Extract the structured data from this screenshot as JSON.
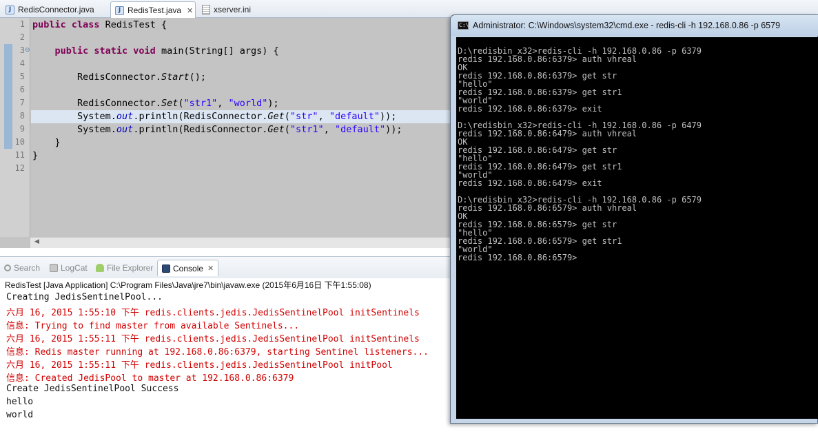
{
  "editor_tabs": [
    {
      "label": "RedisConnector.java",
      "icon": "java-file-icon"
    },
    {
      "label": "RedisTest.java",
      "icon": "java-file-icon",
      "active": true
    },
    {
      "label": "xserver.ini",
      "icon": "ini-file-icon"
    }
  ],
  "editor": {
    "line_numbers": [
      "1",
      "2",
      "3",
      "4",
      "5",
      "6",
      "7",
      "8",
      "9",
      "10",
      "11",
      "12"
    ],
    "lines": [
      [
        {
          "t": "public class",
          "c": "kw"
        },
        {
          "t": " RedisTest {",
          "c": ""
        }
      ],
      [],
      [
        {
          "t": "    ",
          "c": ""
        },
        {
          "t": "public static void",
          "c": "kw"
        },
        {
          "t": " main(String[] args) {",
          "c": ""
        }
      ],
      [],
      [
        {
          "t": "        RedisConnector.",
          "c": ""
        },
        {
          "t": "Start",
          "c": "sm"
        },
        {
          "t": "();",
          "c": ""
        }
      ],
      [],
      [
        {
          "t": "        RedisConnector.",
          "c": ""
        },
        {
          "t": "Set",
          "c": "sm"
        },
        {
          "t": "(",
          "c": ""
        },
        {
          "t": "\"str1\"",
          "c": "str"
        },
        {
          "t": ", ",
          "c": ""
        },
        {
          "t": "\"world\"",
          "c": "str"
        },
        {
          "t": ");",
          "c": ""
        }
      ],
      [
        {
          "t": "        System.",
          "c": ""
        },
        {
          "t": "out",
          "c": "fld"
        },
        {
          "t": ".println(RedisConnector.",
          "c": ""
        },
        {
          "t": "Get",
          "c": "sm"
        },
        {
          "t": "(",
          "c": ""
        },
        {
          "t": "\"str\"",
          "c": "str"
        },
        {
          "t": ", ",
          "c": ""
        },
        {
          "t": "\"default\"",
          "c": "str"
        },
        {
          "t": "));",
          "c": ""
        }
      ],
      [
        {
          "t": "        System.",
          "c": ""
        },
        {
          "t": "out",
          "c": "fld"
        },
        {
          "t": ".println(RedisConnector.",
          "c": ""
        },
        {
          "t": "Get",
          "c": "sm"
        },
        {
          "t": "(",
          "c": ""
        },
        {
          "t": "\"str1\"",
          "c": "str"
        },
        {
          "t": ", ",
          "c": ""
        },
        {
          "t": "\"default\"",
          "c": "str"
        },
        {
          "t": "));",
          "c": ""
        }
      ],
      [
        {
          "t": "    }",
          "c": ""
        }
      ],
      [
        {
          "t": "}",
          "c": ""
        }
      ],
      []
    ]
  },
  "views": {
    "tabs": [
      {
        "label": "Search",
        "icon": "search-icon"
      },
      {
        "label": "LogCat",
        "icon": "logcat-icon"
      },
      {
        "label": "File Explorer",
        "icon": "android-icon"
      },
      {
        "label": "Console",
        "icon": "console-icon",
        "active": true
      }
    ]
  },
  "console": {
    "title": "RedisTest [Java Application] C:\\Program Files\\Java\\jre7\\bin\\javaw.exe (2015年6月16日 下午1:55:08)",
    "lines": [
      {
        "text": "Creating JedisSentinelPool...",
        "type": "out"
      },
      {
        "text": "六月 16, 2015 1:55:10 下午 redis.clients.jedis.JedisSentinelPool initSentinels",
        "type": "err"
      },
      {
        "text": "信息: Trying to find master from available Sentinels...",
        "type": "err"
      },
      {
        "text": "六月 16, 2015 1:55:11 下午 redis.clients.jedis.JedisSentinelPool initSentinels",
        "type": "err"
      },
      {
        "text": "信息: Redis master running at 192.168.0.86:6379, starting Sentinel listeners...",
        "type": "err"
      },
      {
        "text": "六月 16, 2015 1:55:11 下午 redis.clients.jedis.JedisSentinelPool initPool",
        "type": "err"
      },
      {
        "text": "信息: Created JedisPool to master at 192.168.0.86:6379",
        "type": "err"
      },
      {
        "text": "Create JedisSentinelPool Success",
        "type": "out"
      },
      {
        "text": "hello",
        "type": "out"
      },
      {
        "text": "world",
        "type": "out"
      }
    ]
  },
  "cmd": {
    "title": "Administrator: C:\\Windows\\system32\\cmd.exe - redis-cli  -h 192.168.0.86 -p 6579",
    "lines": [
      "D:\\redisbin_x32>redis-cli -h 192.168.0.86 -p 6379",
      "redis 192.168.0.86:6379> auth vhreal",
      "OK",
      "redis 192.168.0.86:6379> get str",
      "\"hello\"",
      "redis 192.168.0.86:6379> get str1",
      "\"world\"",
      "redis 192.168.0.86:6379> exit",
      "",
      "D:\\redisbin_x32>redis-cli -h 192.168.0.86 -p 6479",
      "redis 192.168.0.86:6479> auth vhreal",
      "OK",
      "redis 192.168.0.86:6479> get str",
      "\"hello\"",
      "redis 192.168.0.86:6479> get str1",
      "\"world\"",
      "redis 192.168.0.86:6479> exit",
      "",
      "D:\\redisbin_x32>redis-cli -h 192.168.0.86 -p 6579",
      "redis 192.168.0.86:6579> auth vhreal",
      "OK",
      "redis 192.168.0.86:6579> get str",
      "\"hello\"",
      "redis 192.168.0.86:6579> get str1",
      "\"world\"",
      "redis 192.168.0.86:6579>"
    ]
  }
}
